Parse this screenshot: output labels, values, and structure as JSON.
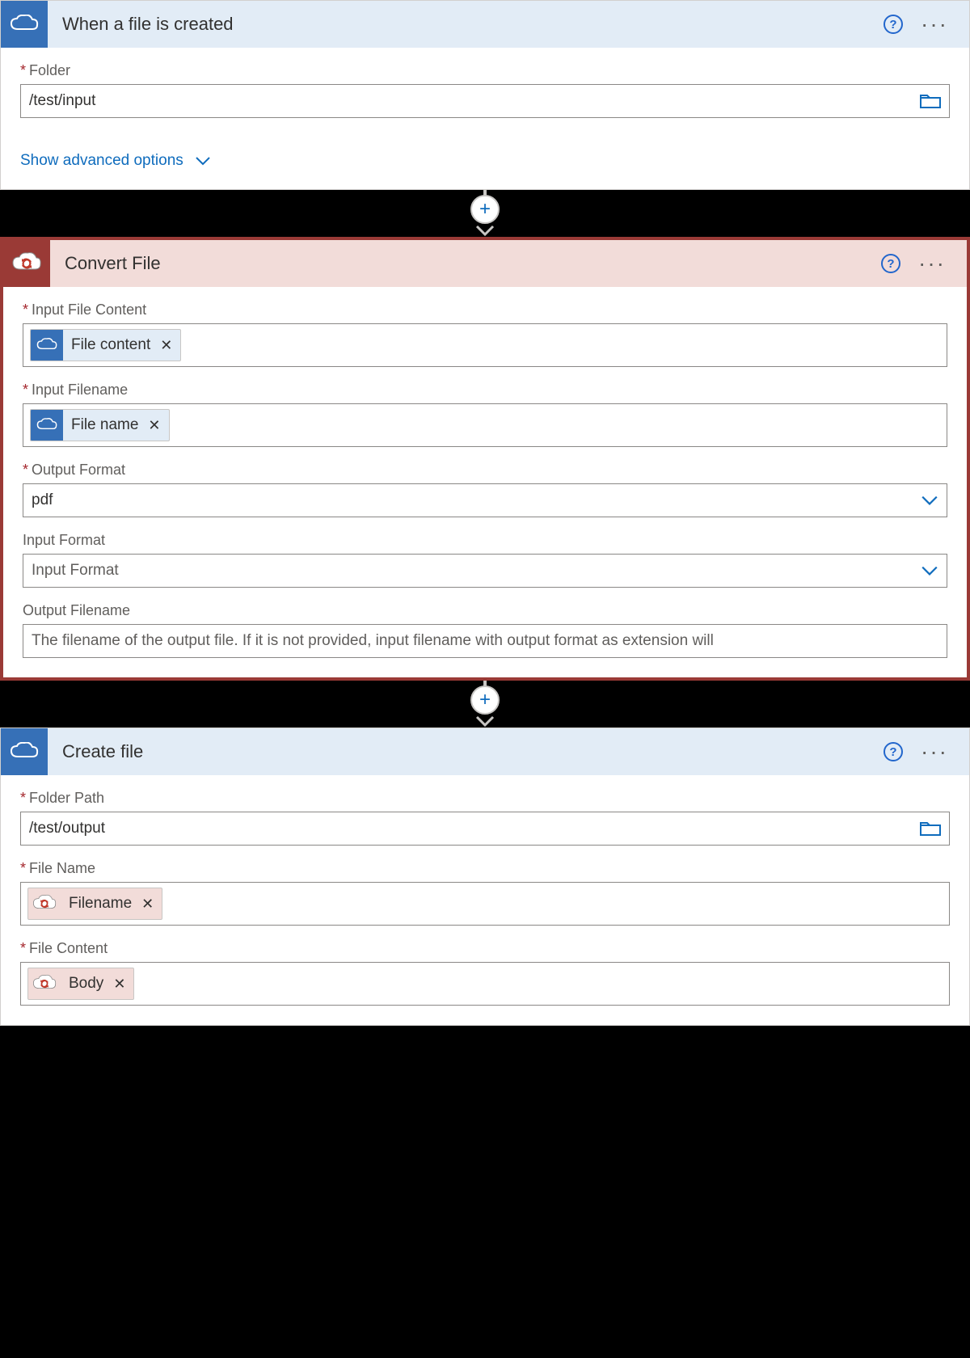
{
  "step1": {
    "title": "When a file is created",
    "fields": {
      "folder": {
        "label": "Folder",
        "value": "/test/input",
        "required": true
      }
    },
    "advanced_link": "Show advanced options"
  },
  "step2": {
    "title": "Convert File",
    "fields": {
      "input_file_content": {
        "label": "Input File Content",
        "token": "File content",
        "required": true
      },
      "input_filename": {
        "label": "Input Filename",
        "token": "File name",
        "required": true
      },
      "output_format": {
        "label": "Output Format",
        "value": "pdf",
        "required": true
      },
      "input_format": {
        "label": "Input Format",
        "placeholder": "Input Format",
        "required": false
      },
      "output_filename": {
        "label": "Output Filename",
        "placeholder": "The filename of the output file. If it is not provided, input filename with output format as extension will",
        "required": false
      }
    }
  },
  "step3": {
    "title": "Create file",
    "fields": {
      "folder_path": {
        "label": "Folder Path",
        "value": "/test/output",
        "required": true
      },
      "file_name": {
        "label": "File Name",
        "token": "Filename",
        "required": true
      },
      "file_content": {
        "label": "File Content",
        "token": "Body",
        "required": true
      }
    }
  },
  "icons": {
    "help": "?",
    "close": "✕",
    "plus": "+"
  }
}
